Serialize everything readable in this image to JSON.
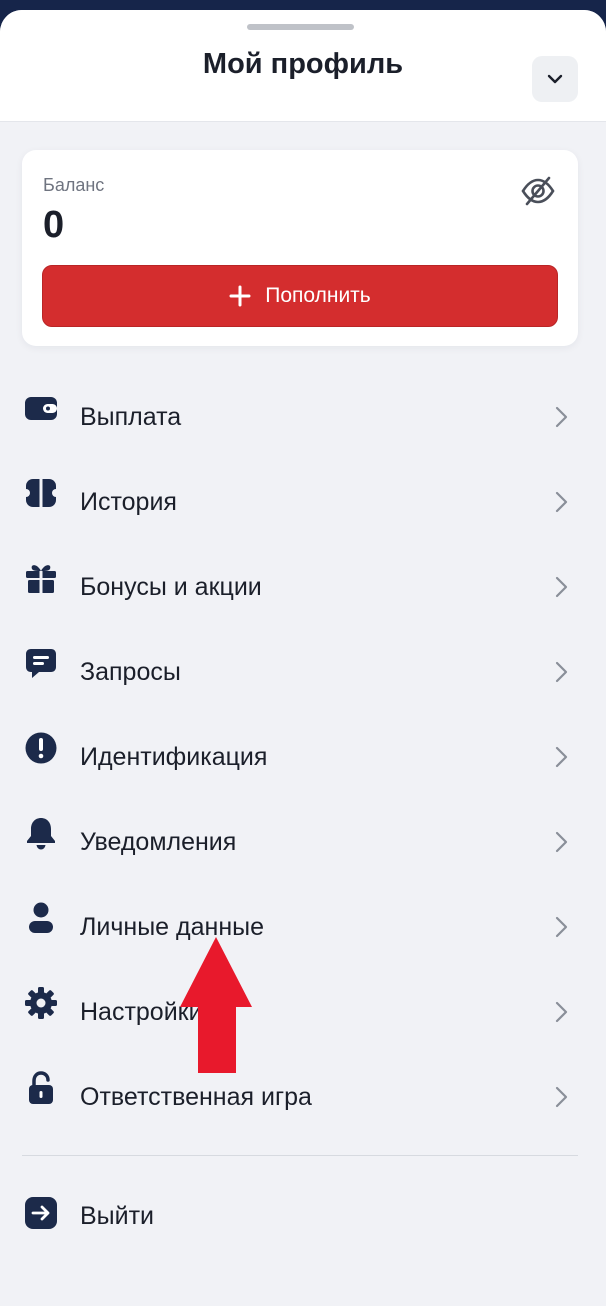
{
  "header": {
    "title": "Мой профиль",
    "collapse_icon": "chevron-down-icon"
  },
  "balance": {
    "label": "Баланс",
    "value": "0",
    "visibility_icon": "eye-off-icon",
    "topup_label": "Пополнить",
    "topup_icon": "plus-icon"
  },
  "menu": {
    "items": [
      {
        "label": "Выплата",
        "icon": "wallet-icon"
      },
      {
        "label": "История",
        "icon": "history-icon"
      },
      {
        "label": "Бонусы и акции",
        "icon": "gift-icon"
      },
      {
        "label": "Запросы",
        "icon": "chat-icon"
      },
      {
        "label": "Идентификация",
        "icon": "alert-circle-icon"
      },
      {
        "label": "Уведомления",
        "icon": "bell-icon"
      },
      {
        "label": "Личные данные",
        "icon": "user-icon"
      },
      {
        "label": "Настройки",
        "icon": "gear-icon"
      },
      {
        "label": "Ответственная игра",
        "icon": "lock-icon"
      }
    ]
  },
  "logout": {
    "label": "Выйти",
    "icon": "logout-icon"
  },
  "colors": {
    "accent_red": "#d42d2e",
    "icon_navy": "#1c2a4a",
    "background": "#f1f2f6",
    "annotation_arrow": "#e8192c"
  }
}
